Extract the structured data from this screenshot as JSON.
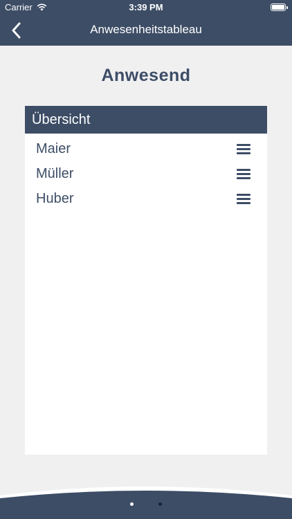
{
  "status_bar": {
    "carrier": "Carrier",
    "time": "3:39 PM",
    "wifi_icon": "wifi-icon",
    "battery_icon": "battery-icon"
  },
  "nav": {
    "back_icon": "chevron-left-icon",
    "title": "Anwesenheitstableau"
  },
  "heading": "Anwesend",
  "panel": {
    "header": "Übersicht",
    "items": [
      {
        "label": "Maier",
        "icon": "drag-handle-icon"
      },
      {
        "label": "Müller",
        "icon": "drag-handle-icon"
      },
      {
        "label": "Huber",
        "icon": "drag-handle-icon"
      }
    ]
  },
  "page_indicator": {
    "count": 2,
    "active_index": 1
  },
  "colors": {
    "primary": "#3d4d66",
    "background": "#f0f0f1",
    "panel": "#ffffff"
  }
}
